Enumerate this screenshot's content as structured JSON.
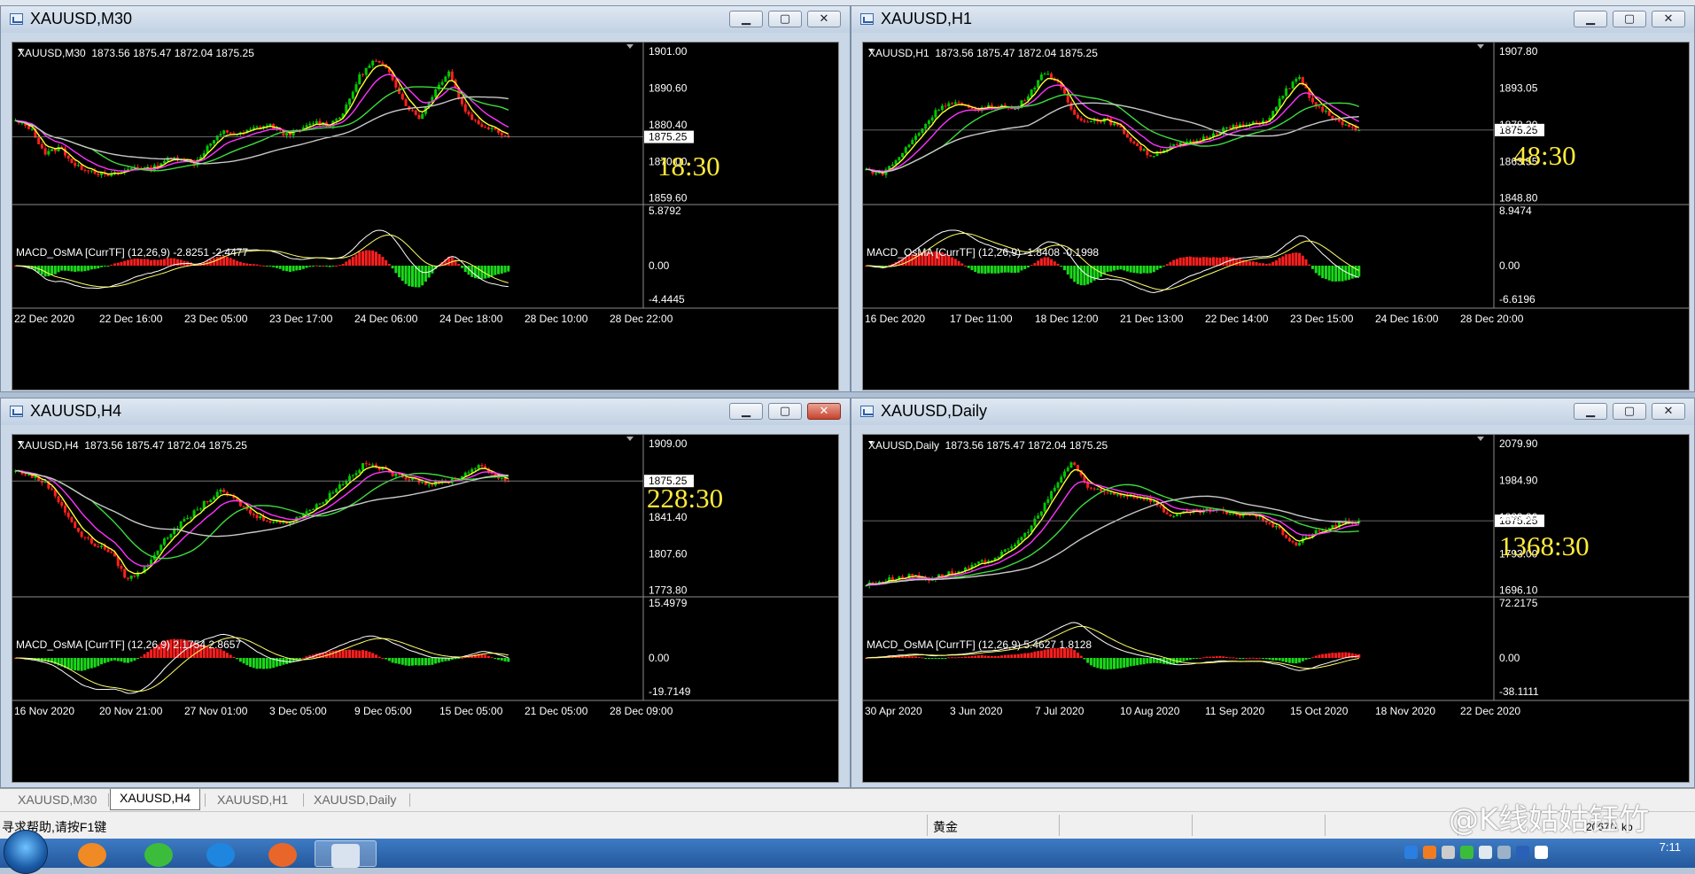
{
  "tabs": [
    "XAUUSD,M30",
    "XAUUSD,H4",
    "XAUUSD,H1",
    "XAUUSD,Daily"
  ],
  "active_tab": "XAUUSD,H4",
  "status": {
    "help": "寻求帮助,请按F1键",
    "symbol": "黄金"
  },
  "watermark": "@K线姑姑钰竹",
  "tray": {
    "time": "7:11",
    "kb": "2067/1 kb"
  },
  "colors": {
    "bull": "#00c800",
    "bear": "#ff1f1f",
    "fast_ma": "#ffff33",
    "slow_ma": "#ff33ff",
    "green_ma": "#3ddc3d",
    "long_ma": "#c8c8c8",
    "osma_up": "#ff1f1f",
    "osma_down": "#19d919"
  },
  "windows": [
    {
      "title": "XAUUSD,M30",
      "ohlc": "XAUUSD,M30  1873.56 1875.47 1872.04 1875.25",
      "macd": "MACD_OsMA [CurrTF] (12,26,9) -2.8251 -2.4477",
      "timer": "18:30",
      "price_ticks": [
        "1901.00",
        "1890.60",
        "1880.40",
        "1870.00",
        "1859.60"
      ],
      "current_price": "1875.25",
      "macd_ticks": [
        "5.8792",
        "0.00",
        "-4.4445"
      ],
      "time_labels": [
        "22 Dec 2020",
        "22 Dec 16:00",
        "23 Dec 05:00",
        "23 Dec 17:00",
        "24 Dec 06:00",
        "24 Dec 18:00",
        "28 Dec 10:00",
        "28 Dec 22:00"
      ],
      "chart_data": {
        "type": "candlestick",
        "ylim": [
          1855,
          1903
        ],
        "last": 1875.25,
        "path": [
          1880,
          1878,
          1870,
          1872,
          1866,
          1865,
          1863,
          1864,
          1866,
          1865,
          1868,
          1869,
          1867,
          1873,
          1877,
          1876,
          1878,
          1879,
          1876,
          1877,
          1880,
          1879,
          1883,
          1894,
          1899,
          1896,
          1886,
          1881,
          1889,
          1896,
          1884,
          1879,
          1878,
          1875
        ]
      }
    },
    {
      "title": "XAUUSD,H1",
      "ohlc": "XAUUSD,H1  1873.56 1875.47 1872.04 1875.25",
      "macd": "MACD_OsMA [CurrTF] (12,26,9) -1.8408 -0.1998",
      "timer": "48:30",
      "price_ticks": [
        "1907.80",
        "1893.05",
        "1878.30",
        "1863.55",
        "1848.80"
      ],
      "current_price": "1875.25",
      "macd_ticks": [
        "8.9474",
        "0.00",
        "-6.6196"
      ],
      "time_labels": [
        "16 Dec 2020",
        "17 Dec 11:00",
        "18 Dec 12:00",
        "21 Dec 13:00",
        "22 Dec 14:00",
        "23 Dec 15:00",
        "24 Dec 16:00",
        "28 Dec 20:00"
      ],
      "chart_data": {
        "type": "candlestick",
        "ylim": [
          1844,
          1911
        ],
        "last": 1875.25,
        "path": [
          1858,
          1856,
          1862,
          1870,
          1878,
          1886,
          1887,
          1884,
          1885,
          1886,
          1884,
          1892,
          1901,
          1894,
          1881,
          1879,
          1880,
          1876,
          1869,
          1864,
          1867,
          1869,
          1870,
          1873,
          1876,
          1877,
          1878,
          1880,
          1892,
          1898,
          1886,
          1882,
          1877,
          1875
        ]
      }
    },
    {
      "title": "XAUUSD,H4",
      "ohlc": "XAUUSD,H4  1873.56 1875.47 1872.04 1875.25",
      "macd": "MACD_OsMA [CurrTF] (12,26,9) 2.1754 2.8657",
      "timer": "228:30",
      "price_ticks": [
        "1909.00",
        "1875.25",
        "1841.40",
        "1807.60",
        "1773.80"
      ],
      "current_price": "1875.25",
      "macd_ticks": [
        "15.4979",
        "0.00",
        "-19.7149"
      ],
      "time_labels": [
        "16 Nov 2020",
        "20 Nov 21:00",
        "27 Nov 01:00",
        "3 Dec 05:00",
        "9 Dec 05:00",
        "15 Dec 05:00",
        "21 Dec 05:00",
        "28 Dec 09:00"
      ],
      "chart_data": {
        "type": "candlestick",
        "ylim": [
          1768,
          1914
        ],
        "last": 1875.25,
        "path": [
          1885,
          1880,
          1872,
          1850,
          1825,
          1815,
          1808,
          1782,
          1790,
          1812,
          1830,
          1842,
          1856,
          1866,
          1855,
          1842,
          1838,
          1835,
          1844,
          1852,
          1866,
          1879,
          1892,
          1887,
          1880,
          1878,
          1872,
          1874,
          1879,
          1890,
          1882,
          1875
        ]
      }
    },
    {
      "title": "XAUUSD,Daily",
      "ohlc": "XAUUSD,Daily  1873.56 1875.47 1872.04 1875.25",
      "macd": "MACD_OsMA [CurrTF] (12,26,9) 5.4627 1.8128",
      "timer": "1368:30",
      "price_ticks": [
        "2079.90",
        "1984.90",
        "1889.90",
        "1793.00",
        "1696.10"
      ],
      "current_price": "1875.25",
      "macd_ticks": [
        "72.2175",
        "0.00",
        "-38.1111"
      ],
      "time_labels": [
        "30 Apr 2020",
        "3 Jun 2020",
        "7 Jul 2020",
        "10 Aug 2020",
        "11 Sep 2020",
        "15 Oct 2020",
        "18 Nov 2020",
        "22 Dec 2020"
      ],
      "chart_data": {
        "type": "candlestick",
        "ylim": [
          1680,
          2090
        ],
        "last": 1875.25,
        "path": [
          1705,
          1715,
          1725,
          1730,
          1720,
          1735,
          1740,
          1760,
          1775,
          1800,
          1840,
          1900,
          1975,
          2035,
          1960,
          1950,
          1945,
          1940,
          1930,
          1890,
          1895,
          1900,
          1905,
          1890,
          1895,
          1880,
          1850,
          1810,
          1840,
          1855,
          1870,
          1875
        ]
      }
    }
  ]
}
